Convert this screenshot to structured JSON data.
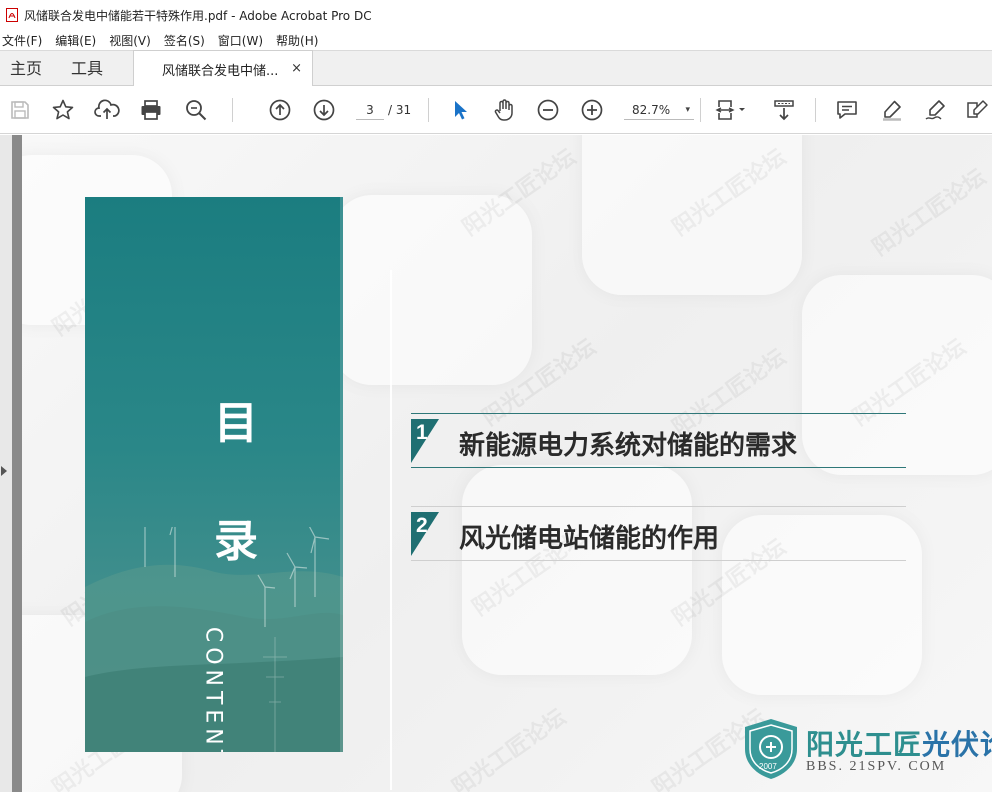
{
  "window": {
    "title": "风储联合发电中储能若干特殊作用.pdf - Adobe Acrobat Pro DC"
  },
  "menu": [
    "文件(F)",
    "编辑(E)",
    "视图(V)",
    "签名(S)",
    "窗口(W)",
    "帮助(H)"
  ],
  "tabs": {
    "home": "主页",
    "tools": "工具",
    "document": "风储联合发电中储...",
    "close_symbol": "×"
  },
  "toolbar": {
    "current_page": "3",
    "total_pages": "/ 31",
    "zoom": "82.7%",
    "zoom_caret": "▾",
    "icons": [
      "save-icon",
      "bookmark-star-icon",
      "upload-cloud-icon",
      "print-icon",
      "zoom-search-icon",
      "page-up-icon",
      "page-down-icon",
      "select-cursor-icon",
      "hand-tool-icon",
      "zoom-out-icon",
      "zoom-in-icon",
      "fit-page-icon",
      "scroll-mode-icon",
      "comment-icon",
      "highlight-icon",
      "sign-icon",
      "edit-pdf-icon"
    ],
    "accent": "#1a73c8"
  },
  "slide": {
    "panel_title": "目录",
    "panel_title_chars": [
      "目",
      "录"
    ],
    "panel_subtitle": "CONTENTS",
    "panel_color": "#1b7d80",
    "toc": [
      {
        "num": "1",
        "text": "新能源电力系统对储能的需求"
      },
      {
        "num": "2",
        "text": "风光储电站储能的作用"
      }
    ],
    "logo": {
      "main_a": "阳光工匠",
      "main_b": "光伏论坛",
      "sub": "BBS. 21SPV. COM",
      "year": "2007"
    },
    "watermark": "阳光工匠论坛"
  }
}
